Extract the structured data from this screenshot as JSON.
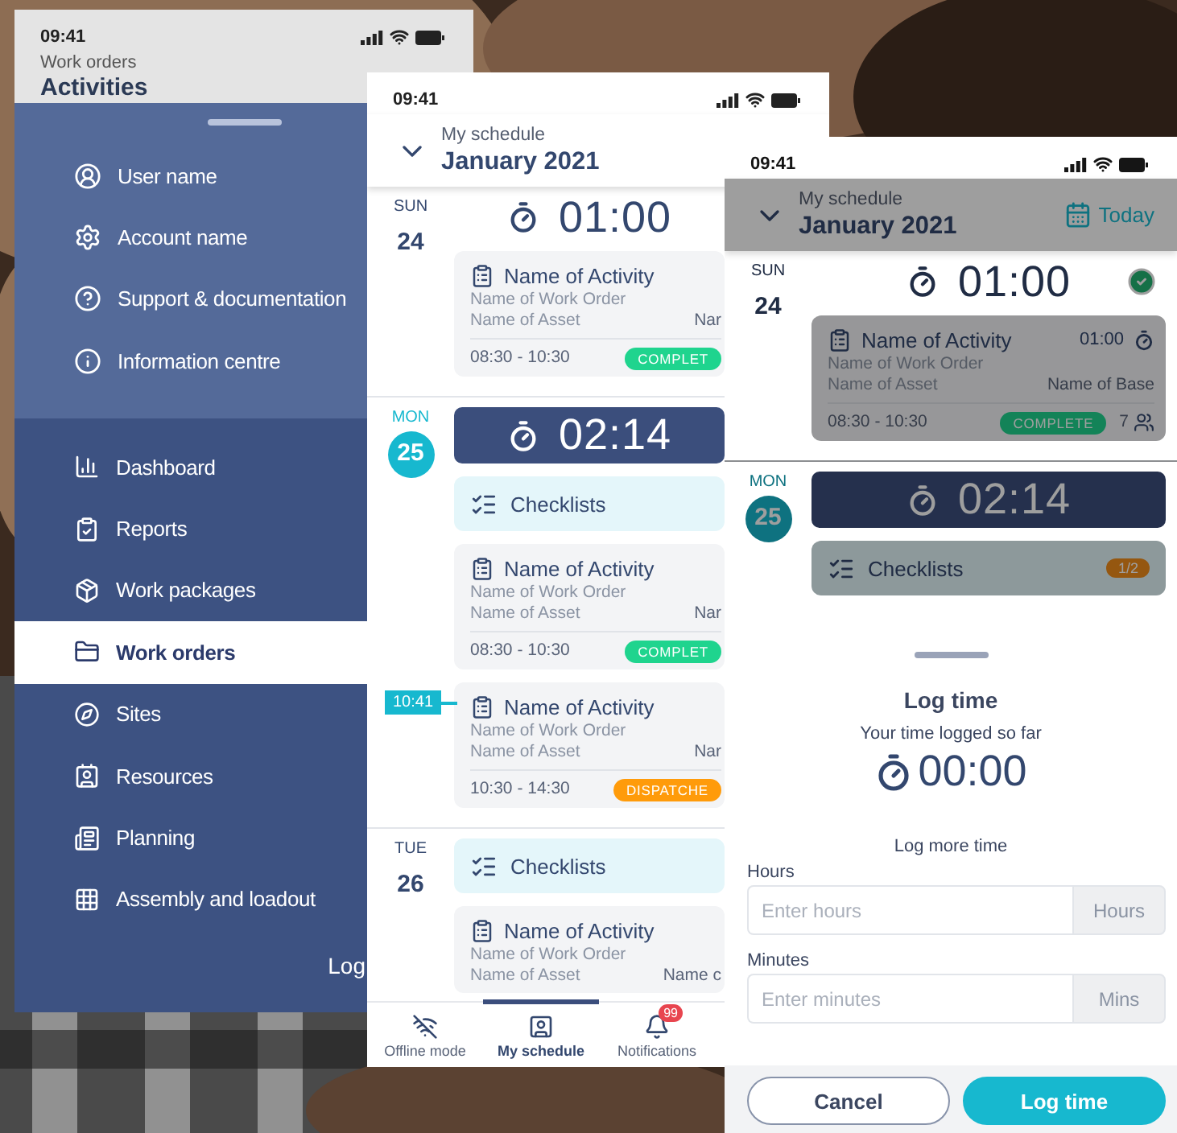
{
  "menu_screen": {
    "status_time": "09:41",
    "header": {
      "subtitle": "Work orders",
      "title": "Activities"
    },
    "account_items": [
      {
        "label": "User name"
      },
      {
        "label": "Account name"
      },
      {
        "label": "Support & documentation"
      },
      {
        "label": "Information centre"
      }
    ],
    "nav_items": [
      {
        "label": "Dashboard",
        "selected": false
      },
      {
        "label": "Reports",
        "selected": false
      },
      {
        "label": "Work packages",
        "selected": false
      },
      {
        "label": "Work orders",
        "selected": true
      },
      {
        "label": "Sites",
        "selected": false
      },
      {
        "label": "Resources",
        "selected": false
      },
      {
        "label": "Planning",
        "selected": false
      },
      {
        "label": "Assembly and loadout",
        "selected": false
      }
    ],
    "logout": "Log"
  },
  "schedule_screen": {
    "status_time": "09:41",
    "header": {
      "subtitle": "My schedule",
      "title": "January 2021"
    },
    "days": [
      {
        "weekday": "SUN",
        "day": "24",
        "selected": false,
        "entries": [
          {
            "kind": "timer",
            "time": "01:00",
            "active": false
          },
          {
            "kind": "activity",
            "name": "Name of Activity",
            "work_order": "Name of Work Order",
            "asset": "Name of Asset",
            "base": "Nar",
            "time_range": "08:30 - 10:30",
            "status": {
              "label": "COMPLET",
              "color": "#1fd48e"
            }
          }
        ]
      },
      {
        "weekday": "MON",
        "day": "25",
        "selected": true,
        "entries": [
          {
            "kind": "timer",
            "time": "02:14",
            "active": true
          },
          {
            "kind": "checklists",
            "label": "Checklists"
          },
          {
            "kind": "activity",
            "name": "Name of Activity",
            "work_order": "Name of Work Order",
            "asset": "Name of Asset",
            "base": "Nar",
            "time_range": "08:30 - 10:30",
            "status": {
              "label": "COMPLET",
              "color": "#1fd48e"
            }
          },
          {
            "kind": "activity",
            "now_marker": "10:41",
            "name": "Name of Activity",
            "work_order": "Name of Work Order",
            "asset": "Name of Asset",
            "base": "Nar",
            "time_range": "10:30 - 14:30",
            "status": {
              "label": "DISPATCHE",
              "color": "#ff9b0a"
            }
          }
        ]
      },
      {
        "weekday": "TUE",
        "day": "26",
        "selected": false,
        "entries": [
          {
            "kind": "checklists",
            "label": "Checklists"
          },
          {
            "kind": "activity",
            "name": "Name of Activity",
            "work_order": "Name of Work Order",
            "asset": "Name of Asset",
            "base": "Name c"
          }
        ]
      }
    ],
    "nav": [
      {
        "label": "Offline mode",
        "selected": false
      },
      {
        "label": "My schedule",
        "selected": true
      },
      {
        "label": "Notifications",
        "selected": false,
        "badge": "99"
      }
    ]
  },
  "log_time_screen": {
    "status_time": "09:41",
    "header": {
      "subtitle": "My schedule",
      "title": "January 2021"
    },
    "today": "Today",
    "days": [
      {
        "weekday": "SUN",
        "day": "24",
        "selected": false,
        "entries": [
          {
            "kind": "timer",
            "time": "01:00",
            "active": false,
            "done": true
          },
          {
            "kind": "activity",
            "name": "Name of Activity",
            "duration": "01:00",
            "work_order": "Name of Work Order",
            "asset": "Name of Asset",
            "base": "Name of Base",
            "time_range": "08:30 - 10:30",
            "status": {
              "label": "COMPLETE",
              "color": "#138358"
            },
            "people": "7"
          }
        ]
      },
      {
        "weekday": "MON",
        "day": "25",
        "selected": true,
        "entries": [
          {
            "kind": "timer",
            "time": "02:14",
            "active": true
          },
          {
            "kind": "checklists",
            "label": "Checklists",
            "badge": "1/2"
          }
        ]
      }
    ],
    "sheet": {
      "title": "Log time",
      "subtitle": "Your time logged so far",
      "total": "00:00",
      "prompt": "Log more time",
      "fields": [
        {
          "label": "Hours",
          "placeholder": "Enter hours",
          "unit": "Hours"
        },
        {
          "label": "Minutes",
          "placeholder": "Enter minutes",
          "unit": "Mins"
        }
      ],
      "buttons": [
        {
          "label": "Cancel",
          "kind": "secondary"
        },
        {
          "label": "Log time",
          "kind": "primary"
        }
      ]
    }
  }
}
